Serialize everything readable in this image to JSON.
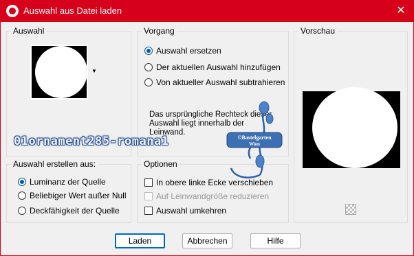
{
  "window": {
    "title": "Auswahl aus Datei laden",
    "close_glyph": "✕"
  },
  "auswahl": {
    "title": "Auswahl"
  },
  "vorgang": {
    "title": "Vorgang",
    "options": [
      "Auswahl ersetzen",
      "Der aktuellen Auswahl hinzufügen",
      "Von aktueller Auswahl subtrahieren"
    ],
    "selected_index": 0,
    "info": "Das ursprüngliche Rechteck dieser Auswahl liegt innerhalb der Leinwand."
  },
  "erstellen": {
    "title": "Auswahl erstellen aus:",
    "options": [
      "Luminanz der Quelle",
      "Beliebiger Wert außer Null",
      "Deckfähigkeit der Quelle"
    ],
    "selected_index": 0
  },
  "optionen": {
    "title": "Optionen",
    "items": [
      {
        "label": "In obere linke Ecke verschieben",
        "checked": false,
        "disabled": false
      },
      {
        "label": "Auf Leinwandgröße reduzieren",
        "checked": false,
        "disabled": true
      },
      {
        "label": "Auswahl umkehren",
        "checked": false,
        "disabled": false
      }
    ]
  },
  "vorschau": {
    "title": "Vorschau"
  },
  "buttons": {
    "laden": "Laden",
    "abbrechen": "Abbrechen",
    "hilfe": "Hilfe"
  },
  "overlay": {
    "watermark": "01ornament285-romana1",
    "stamp_line1": "©Bastelgarten",
    "stamp_line2": "Wien"
  },
  "colors": {
    "titlebar": "#d7001a",
    "accent": "#0067c0"
  }
}
